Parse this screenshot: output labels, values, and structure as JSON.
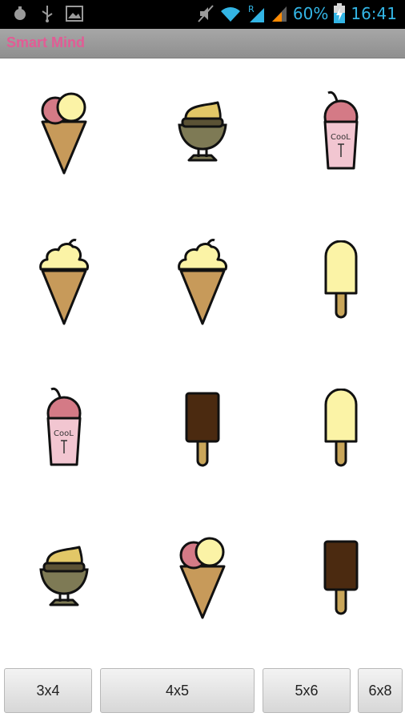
{
  "status_bar": {
    "battery_percent": "60%",
    "time": "16:41",
    "accent_color": "#33b5e5",
    "icons": [
      "debug-icon",
      "usb-icon",
      "gallery-icon",
      "mute-icon",
      "wifi-icon",
      "signal-roaming-icon",
      "signal-icon",
      "battery-charging-icon"
    ]
  },
  "app": {
    "title": "Smart Mind",
    "title_color": "#e25c95"
  },
  "grid": {
    "rows": 4,
    "cols": 3,
    "cards": [
      {
        "icon": "cone-icon"
      },
      {
        "icon": "sundae-cup-icon"
      },
      {
        "icon": "cool-drink-icon"
      },
      {
        "icon": "soft-serve-cone-icon"
      },
      {
        "icon": "soft-serve-cone-icon"
      },
      {
        "icon": "vanilla-popsicle-icon"
      },
      {
        "icon": "cool-drink-icon"
      },
      {
        "icon": "chocolate-popsicle-icon"
      },
      {
        "icon": "vanilla-popsicle-icon"
      },
      {
        "icon": "sundae-cup-icon"
      },
      {
        "icon": "cone-icon"
      },
      {
        "icon": "chocolate-popsicle-icon"
      }
    ]
  },
  "buttons": {
    "size_3x4": "3x4",
    "size_4x5": "4x5",
    "size_5x6": "5x6",
    "size_6x8": "6x8"
  }
}
